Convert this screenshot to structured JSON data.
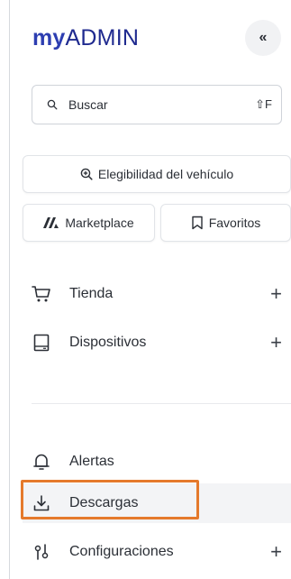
{
  "brand": {
    "my": "my",
    "admin": "ADMIN"
  },
  "header": {
    "collapse_label": "«"
  },
  "search": {
    "placeholder": "Buscar",
    "shortcut": "⇧F"
  },
  "quick_actions": {
    "eligibility": "Elegibilidad del vehículo",
    "marketplace": "Marketplace",
    "favorites": "Favoritos"
  },
  "nav": {
    "items": [
      {
        "label": "Tienda",
        "icon": "cart-icon",
        "expandable": true
      },
      {
        "label": "Dispositivos",
        "icon": "device-icon",
        "expandable": true
      },
      {
        "label": "Alertas",
        "icon": "bell-icon",
        "expandable": false
      },
      {
        "label": "Descargas",
        "icon": "download-icon",
        "expandable": false
      },
      {
        "label": "Configuraciones",
        "icon": "settings-icon",
        "expandable": true
      }
    ],
    "plus": "+"
  },
  "colors": {
    "brand": "#2d3eb1",
    "highlight": "#e57a2c",
    "active_bg": "#f3f4f6"
  }
}
